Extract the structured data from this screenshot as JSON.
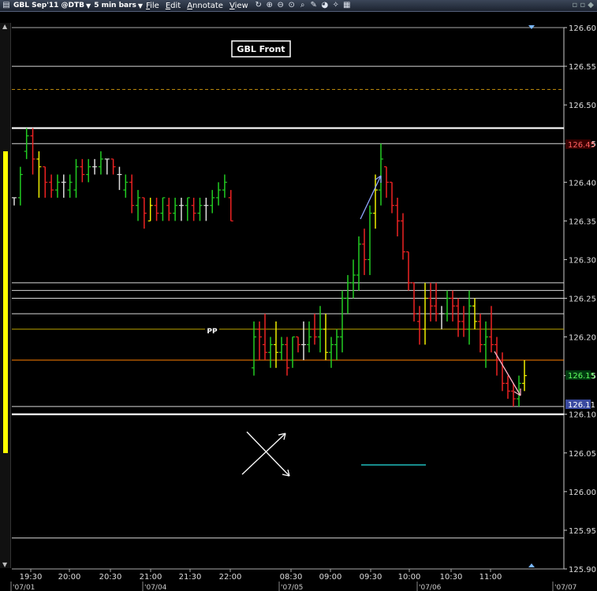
{
  "toolbar": {
    "symbol": "GBL Sep'11 @DTB",
    "interval": "5 min bars",
    "menus": [
      "File",
      "Edit",
      "Annotate",
      "View"
    ]
  },
  "chart_data": {
    "type": "candlestick",
    "title": "GBL Front",
    "ylim": [
      125.9,
      126.6
    ],
    "y_ticks": [
      "126.60",
      "126.55",
      "126.50",
      "126.45",
      "126.40",
      "126.35",
      "126.30",
      "126.25",
      "126.20",
      "126.15",
      "126.10",
      "126.05",
      "126.00",
      "125.95",
      "125.90"
    ],
    "time_ticks": [
      "19:30",
      "20:00",
      "20:30",
      "21:00",
      "21:30",
      "22:00",
      "08:30",
      "09:00",
      "09:30",
      "10:00",
      "10:30",
      "11:00"
    ],
    "date_ticks": [
      "'07/01",
      "'07/04",
      "'07/05",
      "'07/06",
      "'07/07"
    ],
    "last_price_label": "126.15",
    "marker_red_label": "126.45",
    "marker_blue_label": "126.11",
    "pivot_label": "PP",
    "horizontal_levels": [
      {
        "price": 126.55,
        "color": "#d8d8d8",
        "style": "solid"
      },
      {
        "price": 126.52,
        "color": "#b8860b",
        "style": "dashed"
      },
      {
        "price": 126.47,
        "color": "#ffffff",
        "style": "thick"
      },
      {
        "price": 126.45,
        "color": "#d8d8d8",
        "style": "solid"
      },
      {
        "price": 126.27,
        "color": "#d8d8d8",
        "style": "solid"
      },
      {
        "price": 126.26,
        "color": "#d8d8d8",
        "style": "solid"
      },
      {
        "price": 126.25,
        "color": "#d8d8d8",
        "style": "solid"
      },
      {
        "price": 126.23,
        "color": "#d8d8d8",
        "style": "solid"
      },
      {
        "price": 126.21,
        "color": "#b8a000",
        "style": "solid"
      },
      {
        "price": 126.17,
        "color": "#ff8000",
        "style": "solid"
      },
      {
        "price": 126.11,
        "color": "#d8d8d8",
        "style": "solid"
      },
      {
        "price": 126.1,
        "color": "#ffffff",
        "style": "thick"
      },
      {
        "price": 125.94,
        "color": "#d8d8d8",
        "style": "solid"
      }
    ],
    "session1_bars": [
      [
        126.38,
        126.38,
        126.37,
        126.38
      ],
      [
        126.38,
        126.42,
        126.37,
        126.41
      ],
      [
        126.44,
        126.47,
        126.43,
        126.46
      ],
      [
        126.46,
        126.47,
        126.41,
        126.43
      ],
      [
        126.43,
        126.44,
        126.38,
        126.42
      ],
      [
        126.42,
        126.42,
        126.38,
        126.4
      ],
      [
        126.4,
        126.41,
        126.38,
        126.39
      ],
      [
        126.39,
        126.41,
        126.38,
        126.4
      ],
      [
        126.4,
        126.41,
        126.38,
        126.4
      ],
      [
        126.39,
        126.41,
        126.38,
        126.4
      ],
      [
        126.39,
        126.43,
        126.38,
        126.42
      ],
      [
        126.42,
        126.43,
        126.4,
        126.41
      ],
      [
        126.41,
        126.43,
        126.4,
        126.42
      ],
      [
        126.42,
        126.43,
        126.41,
        126.42
      ],
      [
        126.42,
        126.44,
        126.41,
        126.43
      ],
      [
        126.43,
        126.43,
        126.41,
        126.43
      ],
      [
        126.43,
        126.43,
        126.41,
        126.42
      ],
      [
        126.41,
        126.42,
        126.39,
        126.41
      ],
      [
        126.39,
        126.41,
        126.38,
        126.4
      ],
      [
        126.4,
        126.41,
        126.36,
        126.37
      ],
      [
        126.37,
        126.39,
        126.35,
        126.38
      ],
      [
        126.38,
        126.38,
        126.34,
        126.36
      ],
      [
        126.35,
        126.38,
        126.35,
        126.37
      ],
      [
        126.37,
        126.38,
        126.35,
        126.36
      ],
      [
        126.36,
        126.38,
        126.35,
        126.38
      ],
      [
        126.37,
        126.38,
        126.35,
        126.36
      ],
      [
        126.36,
        126.38,
        126.35,
        126.37
      ],
      [
        126.37,
        126.38,
        126.35,
        126.37
      ],
      [
        126.37,
        126.38,
        126.35,
        126.38
      ],
      [
        126.37,
        126.38,
        126.35,
        126.36
      ],
      [
        126.36,
        126.38,
        126.35,
        126.37
      ],
      [
        126.37,
        126.38,
        126.35,
        126.37
      ],
      [
        126.37,
        126.39,
        126.36,
        126.38
      ],
      [
        126.38,
        126.4,
        126.37,
        126.39
      ],
      [
        126.39,
        126.41,
        126.38,
        126.4
      ],
      [
        126.38,
        126.39,
        126.35,
        126.35
      ]
    ],
    "session2_bars": [
      [
        126.16,
        126.22,
        126.15,
        126.2
      ],
      [
        126.21,
        126.22,
        126.17,
        126.2
      ],
      [
        126.19,
        126.23,
        126.17,
        126.18
      ],
      [
        126.18,
        126.2,
        126.16,
        126.19
      ],
      [
        126.19,
        126.22,
        126.16,
        126.18
      ],
      [
        126.18,
        126.2,
        126.17,
        126.19
      ],
      [
        126.19,
        126.2,
        126.15,
        126.16
      ],
      [
        126.17,
        126.2,
        126.16,
        126.2
      ],
      [
        126.2,
        126.2,
        126.18,
        126.19
      ],
      [
        126.19,
        126.22,
        126.17,
        126.19
      ],
      [
        126.19,
        126.22,
        126.18,
        126.2
      ],
      [
        126.21,
        126.23,
        126.19,
        126.2
      ],
      [
        126.2,
        126.24,
        126.18,
        126.21
      ],
      [
        126.21,
        126.23,
        126.17,
        126.18
      ],
      [
        126.18,
        126.2,
        126.16,
        126.19
      ],
      [
        126.19,
        126.21,
        126.17,
        126.2
      ],
      [
        126.2,
        126.26,
        126.18,
        126.25
      ],
      [
        126.25,
        126.28,
        126.23,
        126.27
      ],
      [
        126.27,
        126.3,
        126.25,
        126.28
      ],
      [
        126.28,
        126.33,
        126.26,
        126.32
      ],
      [
        126.32,
        126.34,
        126.28,
        126.3
      ],
      [
        126.3,
        126.37,
        126.28,
        126.36
      ],
      [
        126.36,
        126.41,
        126.34,
        126.39
      ],
      [
        126.39,
        126.45,
        126.37,
        126.43
      ],
      [
        126.42,
        126.42,
        126.38,
        126.4
      ],
      [
        126.4,
        126.4,
        126.36,
        126.37
      ],
      [
        126.37,
        126.38,
        126.33,
        126.35
      ],
      [
        126.35,
        126.36,
        126.3,
        126.31
      ],
      [
        126.31,
        126.31,
        126.26,
        126.27
      ],
      [
        126.27,
        126.27,
        126.22,
        126.23
      ],
      [
        126.22,
        126.24,
        126.19,
        126.21
      ],
      [
        126.21,
        126.27,
        126.19,
        126.25
      ],
      [
        126.25,
        126.27,
        126.22,
        126.24
      ],
      [
        126.24,
        126.27,
        126.22,
        126.23
      ],
      [
        126.23,
        126.24,
        126.21,
        126.23
      ],
      [
        126.23,
        126.26,
        126.22,
        126.25
      ],
      [
        126.25,
        126.26,
        126.22,
        126.24
      ],
      [
        126.24,
        126.25,
        126.2,
        126.22
      ],
      [
        126.22,
        126.24,
        126.2,
        126.21
      ],
      [
        126.21,
        126.26,
        126.19,
        126.24
      ],
      [
        126.24,
        126.25,
        126.21,
        126.22
      ],
      [
        126.22,
        126.23,
        126.18,
        126.19
      ],
      [
        126.19,
        126.22,
        126.16,
        126.2
      ],
      [
        126.2,
        126.24,
        126.18,
        126.19
      ],
      [
        126.19,
        126.2,
        126.15,
        126.17
      ],
      [
        126.17,
        126.18,
        126.13,
        126.14
      ],
      [
        126.14,
        126.15,
        126.12,
        126.13
      ],
      [
        126.13,
        126.14,
        126.11,
        126.12
      ],
      [
        126.12,
        126.15,
        126.11,
        126.14
      ],
      [
        126.14,
        126.17,
        126.13,
        126.15
      ]
    ]
  }
}
